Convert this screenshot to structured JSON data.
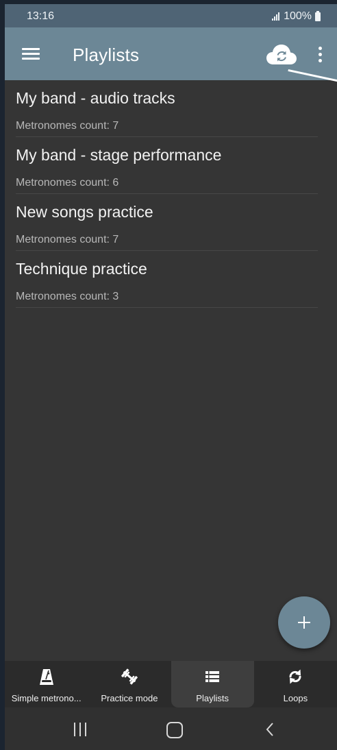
{
  "status_bar": {
    "time": "13:16",
    "battery": "100%"
  },
  "app_bar": {
    "title": "Playlists",
    "icons": [
      "menu-icon",
      "cloud-sync-icon",
      "more-vertical-icon"
    ]
  },
  "playlists": [
    {
      "title": "My band - audio tracks",
      "subtitle": "Metronomes count: 7"
    },
    {
      "title": "My band - stage performance",
      "subtitle": "Metronomes count: 6"
    },
    {
      "title": "New songs practice",
      "subtitle": "Metronomes count: 7"
    },
    {
      "title": "Technique practice",
      "subtitle": "Metronomes count: 3"
    }
  ],
  "fab": {
    "icon": "plus-icon"
  },
  "bottom_nav": {
    "tabs": [
      {
        "label": "Simple metrono...",
        "icon": "metronome-icon",
        "active": false
      },
      {
        "label": "Practice mode",
        "icon": "dumbbell-icon",
        "active": false
      },
      {
        "label": "Playlists",
        "icon": "list-icon",
        "active": true
      },
      {
        "label": "Loops",
        "icon": "loop-icon",
        "active": false
      }
    ]
  },
  "colors": {
    "app_bar": "#6c8796",
    "status_bar": "#4f6475",
    "background": "#353535",
    "bottom_nav": "#2b2b2b",
    "fab": "#6c8796"
  }
}
